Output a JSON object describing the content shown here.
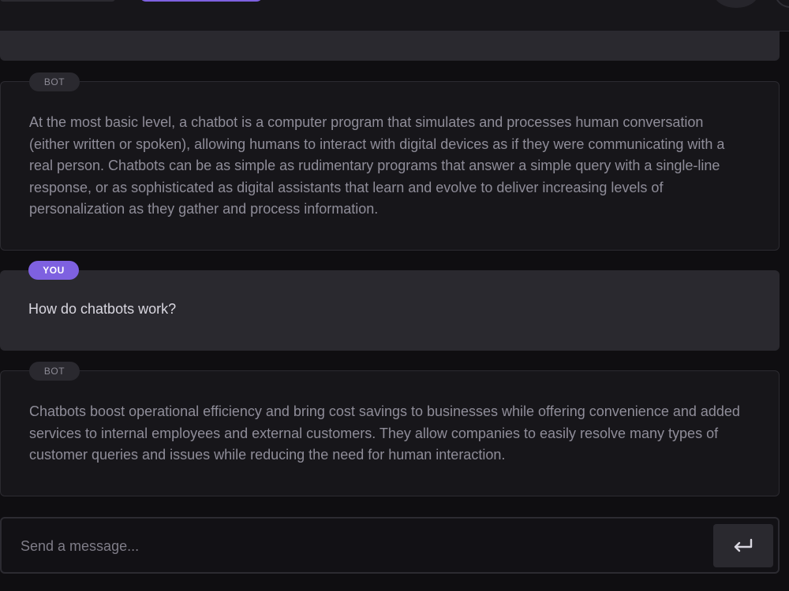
{
  "messages": [
    {
      "role": "bot",
      "label": "BOT",
      "text": "At the most basic level, a chatbot is a computer program that simulates and processes human conversation (either written or spoken), allowing humans to interact with digital devices as if they were communicating with a real person. Chatbots can be as simple as rudimentary programs that answer a simple query with a single-line response, or as sophisticated as digital assistants that learn and evolve to deliver increasing levels of personalization as they gather and process information."
    },
    {
      "role": "user",
      "label": "YOU",
      "text": "How do chatbots work?"
    },
    {
      "role": "bot",
      "label": "BOT",
      "text": "Chatbots boost operational efficiency and bring cost savings to businesses while offering convenience and added services to internal employees and external customers. They allow companies to easily resolve many types of customer queries and issues while reducing the need for human interaction."
    }
  ],
  "input": {
    "placeholder": "Send a message...",
    "value": ""
  },
  "send_button": {
    "icon": "enter-return-icon"
  },
  "colors": {
    "accent": "#7e61e0",
    "background": "#0f0e11",
    "bot_bubble": "#17161a",
    "user_bubble": "#2a292f",
    "bot_text": "#8f8d99",
    "user_text": "#d9d7e0"
  }
}
